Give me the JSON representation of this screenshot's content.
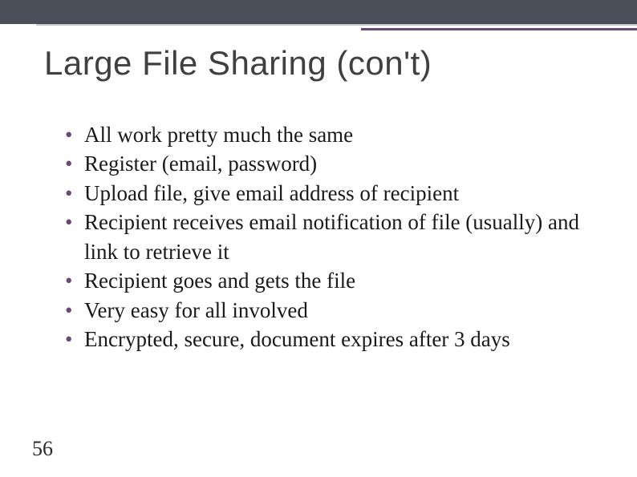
{
  "title": "Large File Sharing (con't)",
  "bullets": [
    "All work pretty much the same",
    "Register (email, password)",
    "Upload file, give email address of recipient",
    "Recipient receives email notification of file (usually) and link to retrieve it",
    "Recipient goes and gets the file",
    "Very easy for all involved",
    "Encrypted, secure, document expires after 3 days"
  ],
  "page_number": "56"
}
